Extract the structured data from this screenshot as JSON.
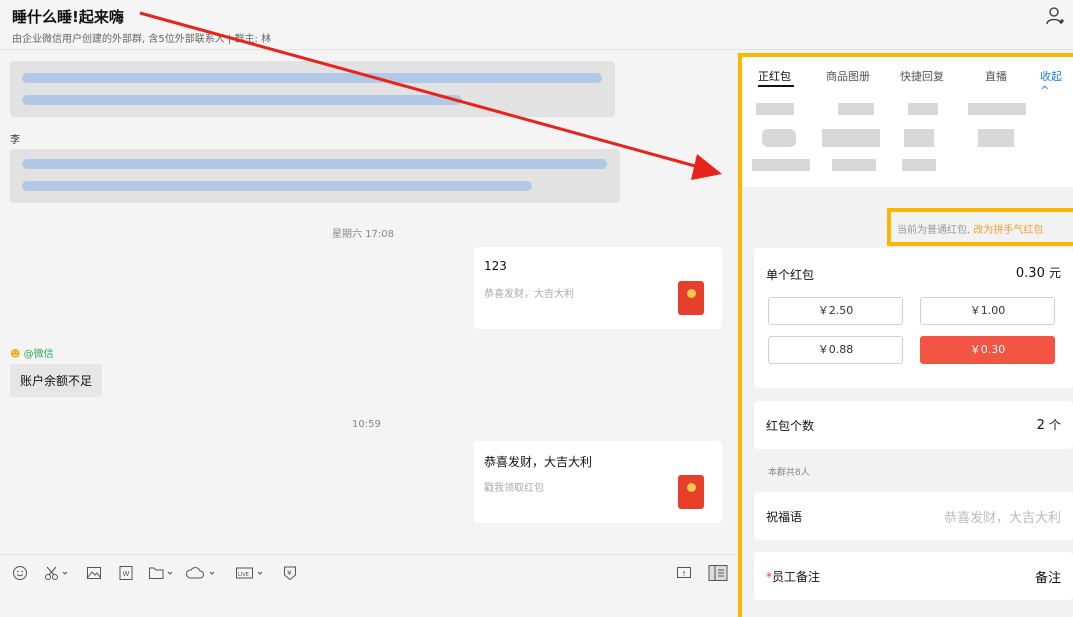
{
  "header": {
    "title": "睡什么睡!起来嗨",
    "subtitle": "由企业微信用户创建的外部群, 含5位外部联系人 | 群主: 林"
  },
  "chat": {
    "sender_name": "李",
    "time1": "星期六 17:08",
    "time2": "10:59",
    "redpacket1": {
      "title": "123",
      "sub": "恭喜发财，大吉大利"
    },
    "redpacket2": {
      "title": "恭喜发财，大吉大利",
      "sub": "戳我领取红包"
    },
    "wechat_tag": "@微信",
    "bubble_text": "账户余额不足"
  },
  "panel": {
    "tabs": [
      "正红包",
      "商品图册",
      "快捷回复",
      "直播",
      "收起"
    ],
    "notice_plain": "当前为普通红包,",
    "notice_link": "改为拼手气红包",
    "single_label": "单个红包",
    "single_value": "0.30",
    "single_unit": "元",
    "amounts": [
      "￥2.50",
      "￥1.00",
      "￥0.88",
      "￥0.30"
    ],
    "count_label": "红包个数",
    "count_value": "2",
    "count_unit": "个",
    "group_note": "本群共8人",
    "blessing_label": "祝福语",
    "blessing_value": "恭喜发财，大吉大利",
    "remark_star": "*",
    "remark_label": "员工备注",
    "remark_value": "备注"
  },
  "colors": {
    "highlight": "#fbb700",
    "selected_amount": "#f25543",
    "arrow": "#e8231a",
    "link": "#1a7fe0"
  }
}
